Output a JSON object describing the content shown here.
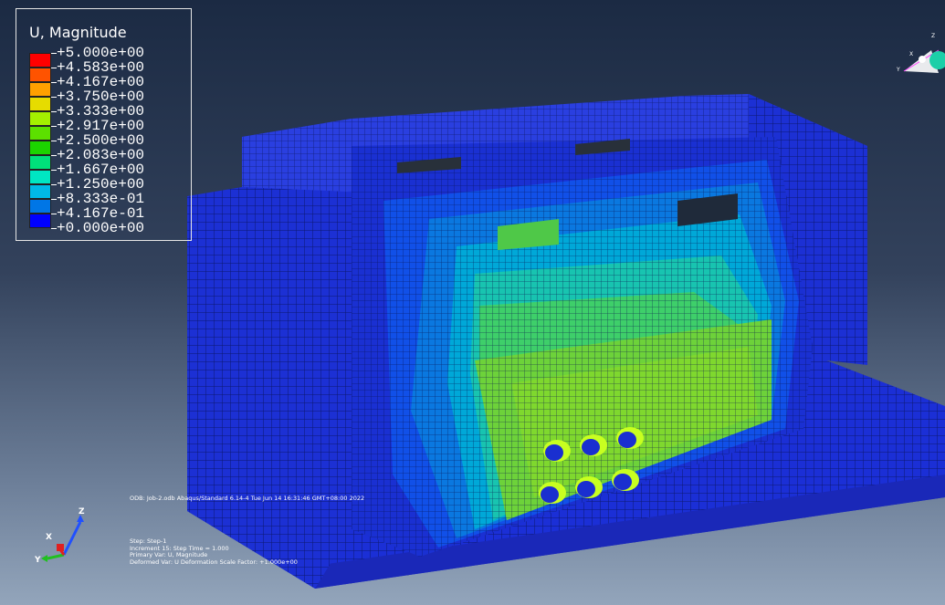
{
  "legend": {
    "title": "U, Magnitude",
    "entries": [
      {
        "label": "+5.000e+00",
        "color": "#ff0000"
      },
      {
        "label": "+4.583e+00",
        "color": "#ff5300"
      },
      {
        "label": "+4.167e+00",
        "color": "#ffa000"
      },
      {
        "label": "+3.750e+00",
        "color": "#e6dc00"
      },
      {
        "label": "+3.333e+00",
        "color": "#a4f000"
      },
      {
        "label": "+2.917e+00",
        "color": "#5ce000"
      },
      {
        "label": "+2.500e+00",
        "color": "#1cd400"
      },
      {
        "label": "+2.083e+00",
        "color": "#00e07a"
      },
      {
        "label": "+1.667e+00",
        "color": "#00e6c2"
      },
      {
        "label": "+1.250e+00",
        "color": "#00b9e6"
      },
      {
        "label": "+8.333e-01",
        "color": "#0076e6"
      },
      {
        "label": "+4.167e-01",
        "color": "#0034e6"
      },
      {
        "label": "+0.000e+00",
        "color": ""
      }
    ],
    "last_swatch_color": "#0000ff"
  },
  "odb_info": {
    "line": "ODB: Job-2.odb    Abaqus/Standard 6.14-4    Tue Jun 14 16:31:46 GMT+08:00 2022"
  },
  "step_info": {
    "step": "Step: Step-1",
    "increment": "Increment    15: Step Time =    1.000",
    "primary_var": "Primary Var: U, Magnitude",
    "deformed_var": "Deformed Var: U   Deformation Scale Factor: +1.000e+00"
  },
  "triad": {
    "x": "X",
    "y": "Y",
    "z": "Z"
  },
  "mini_triad": {
    "x": "X",
    "y": "Y",
    "z": "Z"
  },
  "colors": {
    "mesh_blue": "#1a2fd0",
    "mesh_line": "#0a1260"
  }
}
